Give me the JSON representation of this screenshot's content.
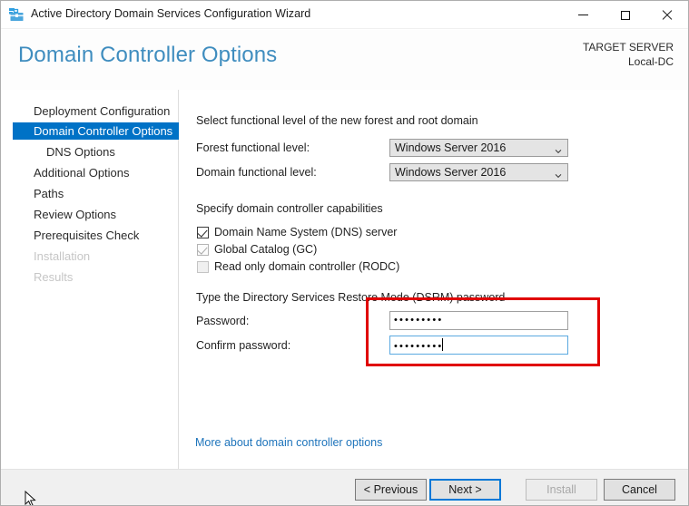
{
  "window": {
    "title": "Active Directory Domain Services Configuration Wizard",
    "icon": "server-manager-toolbox-icon",
    "controls": {
      "minimize": "minimize-icon",
      "maximize": "maximize-icon",
      "close": "close-icon"
    }
  },
  "header": {
    "page_title": "Domain Controller Options",
    "target_server_label": "TARGET SERVER",
    "target_server_name": "Local-DC"
  },
  "sidebar": {
    "items": [
      {
        "label": "Deployment Configuration",
        "state": "normal",
        "indent": false
      },
      {
        "label": "Domain Controller Options",
        "state": "selected",
        "indent": false
      },
      {
        "label": "DNS Options",
        "state": "normal",
        "indent": true
      },
      {
        "label": "Additional Options",
        "state": "normal",
        "indent": false
      },
      {
        "label": "Paths",
        "state": "normal",
        "indent": false
      },
      {
        "label": "Review Options",
        "state": "normal",
        "indent": false
      },
      {
        "label": "Prerequisites Check",
        "state": "normal",
        "indent": false
      },
      {
        "label": "Installation",
        "state": "disabled",
        "indent": false
      },
      {
        "label": "Results",
        "state": "disabled",
        "indent": false
      }
    ]
  },
  "main": {
    "functional_level_heading": "Select functional level of the new forest and root domain",
    "forest_level_label": "Forest functional level:",
    "forest_level_value": "Windows Server 2016",
    "domain_level_label": "Domain functional level:",
    "domain_level_value": "Windows Server 2016",
    "capabilities_heading": "Specify domain controller capabilities",
    "capabilities": [
      {
        "label": "Domain Name System (DNS) server",
        "checked": true,
        "enabled": true
      },
      {
        "label": "Global Catalog (GC)",
        "checked": true,
        "enabled": false
      },
      {
        "label": "Read only domain controller (RODC)",
        "checked": false,
        "enabled": false
      }
    ],
    "dsrm_heading": "Type the Directory Services Restore Mode (DSRM) password",
    "password_label": "Password:",
    "password_value": "•••••••••",
    "confirm_label": "Confirm password:",
    "confirm_value": "•••••••••",
    "more_link": "More about domain controller options",
    "annotation_color": "#e00000",
    "accent_color": "#0072c6",
    "title_color": "#3f8dbf",
    "link_color": "#1e74bb"
  },
  "footer": {
    "previous": "< Previous",
    "next": "Next >",
    "install": "Install",
    "cancel": "Cancel",
    "install_enabled": false,
    "next_is_default": true
  }
}
